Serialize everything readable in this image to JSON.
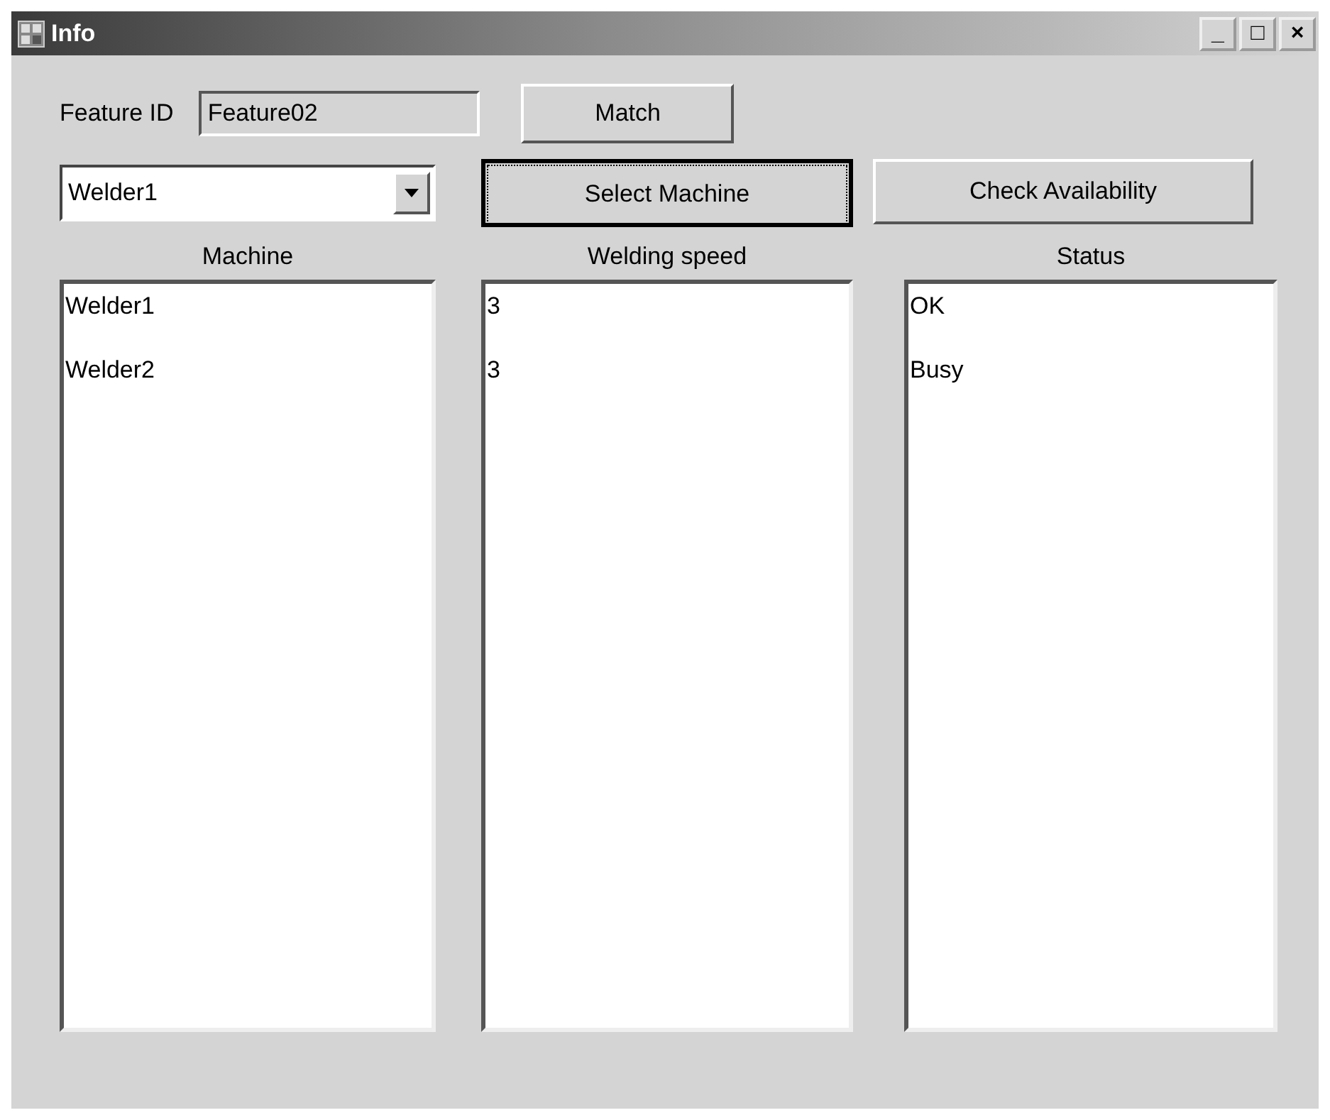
{
  "window": {
    "title": "Info",
    "controls": [
      "_",
      "□",
      "×"
    ]
  },
  "feature": {
    "label": "Feature ID",
    "value": "Feature02"
  },
  "buttons_top": [
    {
      "label": "Match",
      "focused": false
    }
  ],
  "machine_select": {
    "value": "Welder1"
  },
  "buttons": [
    {
      "label": "Select Machine",
      "focused": true
    },
    {
      "label": "Check Availability",
      "focused": false
    }
  ],
  "lists": [
    {
      "header": "Machine",
      "items": [
        "Welder1",
        "Welder2"
      ]
    },
    {
      "header": "Welding speed",
      "items": [
        "3",
        "3"
      ]
    },
    {
      "header": "Status",
      "items": [
        "OK",
        "Busy"
      ]
    }
  ]
}
